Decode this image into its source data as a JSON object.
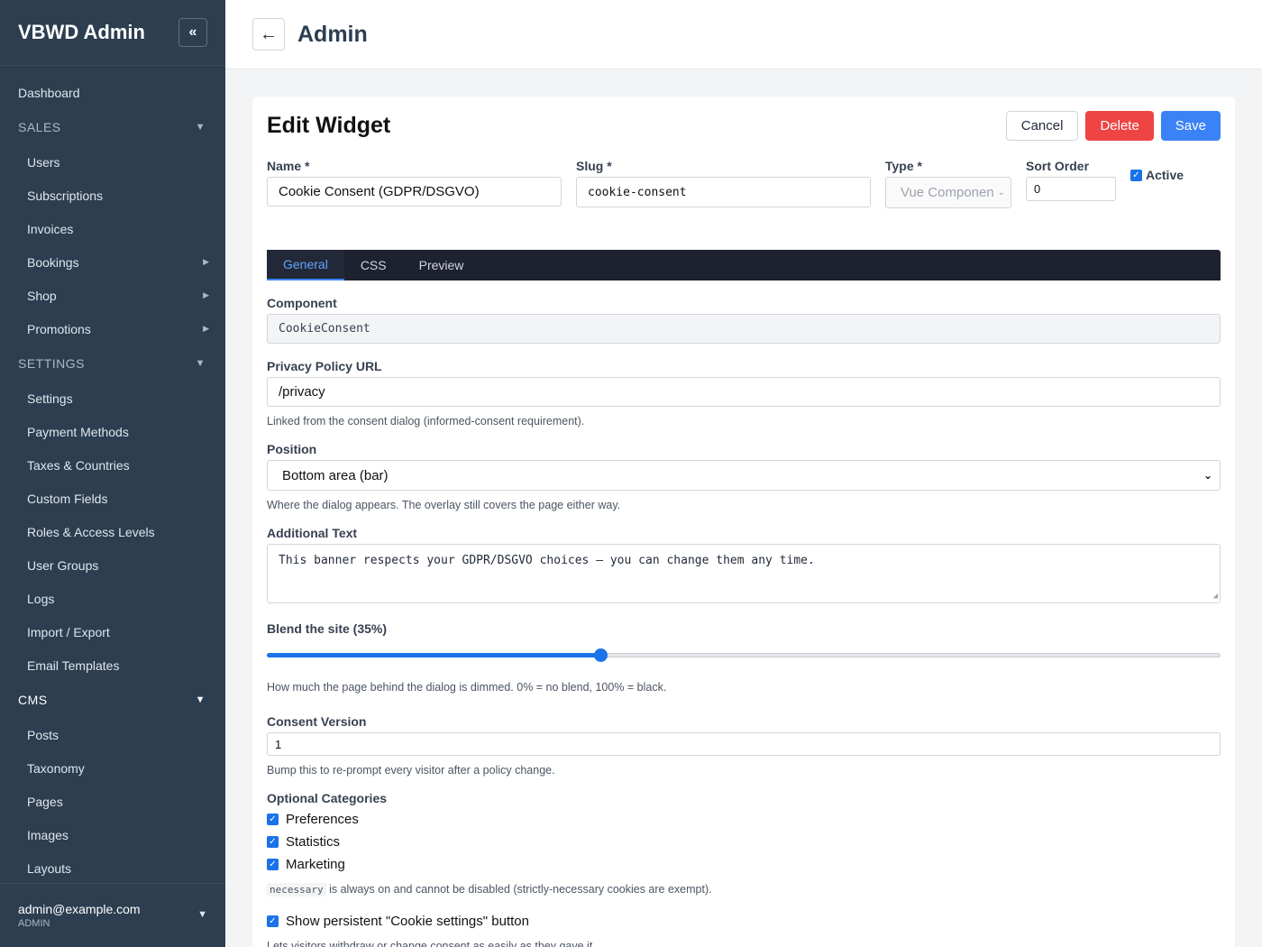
{
  "sidebar": {
    "title": "VBWD Admin",
    "collapse_icon": "«",
    "dashboard": "Dashboard",
    "sales": {
      "label": "SALES",
      "items": [
        {
          "label": "Users"
        },
        {
          "label": "Subscriptions"
        },
        {
          "label": "Invoices"
        },
        {
          "label": "Bookings",
          "has_arrow": true
        },
        {
          "label": "Shop",
          "has_arrow": true
        },
        {
          "label": "Promotions",
          "has_arrow": true
        }
      ]
    },
    "settings": {
      "label": "SETTINGS",
      "items": [
        {
          "label": "Settings"
        },
        {
          "label": "Payment Methods"
        },
        {
          "label": "Taxes & Countries"
        },
        {
          "label": "Custom Fields"
        },
        {
          "label": "Roles & Access Levels"
        },
        {
          "label": "User Groups"
        },
        {
          "label": "Logs"
        },
        {
          "label": "Import / Export"
        },
        {
          "label": "Email Templates"
        }
      ]
    },
    "cms": {
      "label": "CMS",
      "items": [
        {
          "label": "Posts"
        },
        {
          "label": "Taxonomy"
        },
        {
          "label": "Pages"
        },
        {
          "label": "Images"
        },
        {
          "label": "Layouts"
        }
      ]
    },
    "user": {
      "email": "admin@example.com",
      "role": "ADMIN"
    }
  },
  "topbar": {
    "back_icon": "←",
    "title": "Admin"
  },
  "editor": {
    "title": "Edit Widget",
    "buttons": {
      "cancel": "Cancel",
      "delete": "Delete",
      "save": "Save"
    },
    "name": {
      "label": "Name *",
      "value": "Cookie Consent (GDPR/DSGVO)"
    },
    "slug": {
      "label": "Slug *",
      "value": "cookie-consent"
    },
    "type": {
      "label": "Type *",
      "value": "Vue Componen"
    },
    "sort_order": {
      "label": "Sort Order",
      "value": "0"
    },
    "active": {
      "label": "Active",
      "checked": true
    },
    "tabs": [
      {
        "label": "General",
        "active": true
      },
      {
        "label": "CSS",
        "active": false
      },
      {
        "label": "Preview",
        "active": false
      }
    ],
    "component": {
      "label": "Component",
      "value": "CookieConsent"
    },
    "privacy_url": {
      "label": "Privacy Policy URL",
      "value": "/privacy",
      "help": "Linked from the consent dialog (informed-consent requirement)."
    },
    "position": {
      "label": "Position",
      "value": "Bottom area (bar)",
      "help": "Where the dialog appears. The overlay still covers the page either way."
    },
    "additional_text": {
      "label": "Additional Text",
      "value": "This banner respects your GDPR/DSGVO choices — you can change them any time."
    },
    "blend": {
      "label": "Blend the site (35%)",
      "value": 0.35,
      "help": "How much the page behind the dialog is dimmed. 0% = no blend, 100% = black."
    },
    "consent_version": {
      "label": "Consent Version",
      "value": "1",
      "help": "Bump this to re-prompt every visitor after a policy change."
    },
    "optional_categories": {
      "label": "Optional Categories",
      "items": [
        {
          "label": "Preferences",
          "checked": true
        },
        {
          "label": "Statistics",
          "checked": true
        },
        {
          "label": "Marketing",
          "checked": true
        }
      ],
      "necessary_code": "necessary",
      "necessary_help": "is always on and cannot be disabled (strictly-necessary cookies are exempt)."
    },
    "persistent_button": {
      "label": "Show persistent \"Cookie settings\" button",
      "checked": true,
      "help": "Lets visitors withdraw or change consent as easily as they gave it."
    }
  },
  "colors": {
    "sidebar_bg": "#2c3e50",
    "primary": "#3b82f6",
    "danger": "#ef4444",
    "tabs_bg": "#1e2130"
  }
}
